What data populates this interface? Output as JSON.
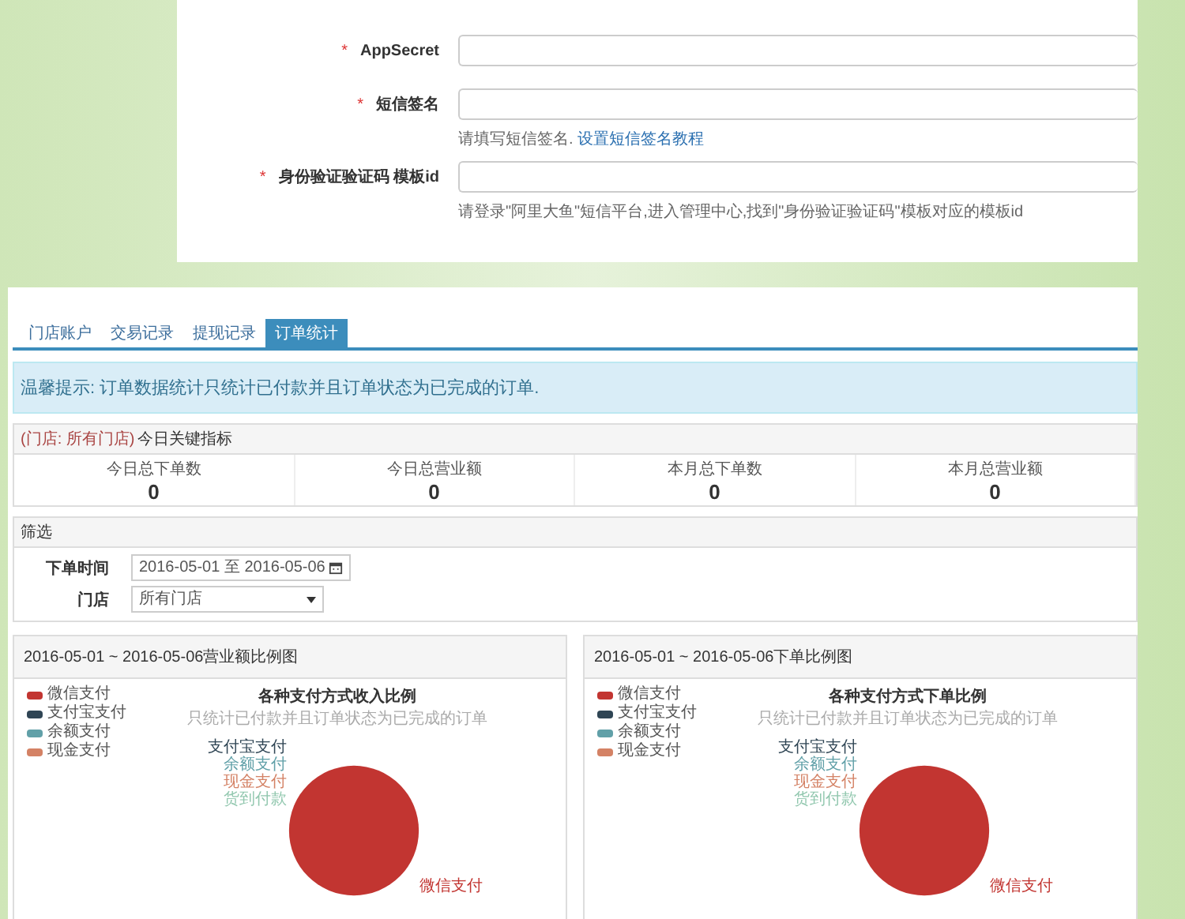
{
  "sms_form": {
    "fields": [
      {
        "label": "AppSecret",
        "required_mark": "*"
      },
      {
        "label": "短信签名",
        "required_mark": "*",
        "hint": {
          "text": "请填写短信签名. ",
          "link": "设置短信签名教程"
        }
      },
      {
        "label": "身份验证验证码 模板id",
        "required_mark": "*",
        "hint": {
          "text": "请登录\"阿里大鱼\"短信平台,进入管理中心,找到\"身份验证验证码\"模板对应的模板id"
        }
      }
    ]
  },
  "tabs": [
    {
      "label": "门店账户",
      "selected": false
    },
    {
      "label": "交易记录",
      "selected": false
    },
    {
      "label": "提现记录",
      "selected": false
    },
    {
      "label": "订单统计",
      "selected": true
    }
  ],
  "alert": "温馨提示: 订单数据统计只统计已付款并且订单状态为已完成的订单.",
  "metrics": {
    "store_tag": "(门店: 所有门店)",
    "title": "今日关键指标",
    "items": [
      {
        "label": "今日总下单数",
        "value": "0"
      },
      {
        "label": "今日总营业额",
        "value": "0"
      },
      {
        "label": "本月总下单数",
        "value": "0"
      },
      {
        "label": "本月总营业额",
        "value": "0"
      }
    ]
  },
  "filter": {
    "title": "筛选",
    "date_label": "下单时间",
    "date_value": "2016-05-01 至 2016-05-06",
    "store_label": "门店",
    "store_value": "所有门店"
  },
  "charts": [
    {
      "panel_title": "2016-05-01 ~ 2016-05-06营业额比例图",
      "title": "各种支付方式收入比例",
      "subtitle": "只统计已付款并且订单状态为已完成的订单",
      "legend": [
        {
          "label": "微信支付",
          "color": "#c23531"
        },
        {
          "label": "支付宝支付",
          "color": "#2f4554"
        },
        {
          "label": "余额支付",
          "color": "#61a0a8"
        },
        {
          "label": "现金支付",
          "color": "#d48265"
        }
      ],
      "slice_labels": [
        "支付宝支付",
        "余额支付",
        "现金支付",
        "货到付款"
      ],
      "main_label": "微信支付"
    },
    {
      "panel_title": "2016-05-01 ~ 2016-05-06下单比例图",
      "title": "各种支付方式下单比例",
      "subtitle": "只统计已付款并且订单状态为已完成的订单",
      "legend": [
        {
          "label": "微信支付",
          "color": "#c23531"
        },
        {
          "label": "支付宝支付",
          "color": "#2f4554"
        },
        {
          "label": "余额支付",
          "color": "#61a0a8"
        },
        {
          "label": "现金支付",
          "color": "#d48265"
        }
      ],
      "slice_labels": [
        "支付宝支付",
        "余额支付",
        "现金支付",
        "货到付款"
      ],
      "main_label": "微信支付"
    }
  ]
}
